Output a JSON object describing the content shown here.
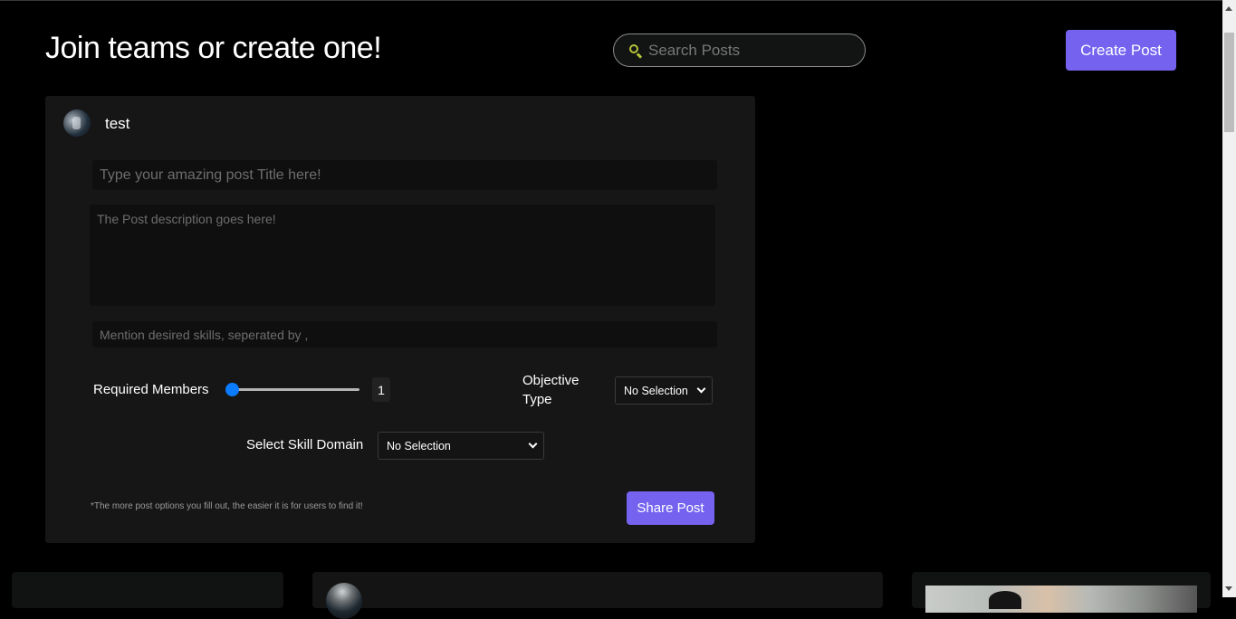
{
  "header": {
    "title": "Join teams or create one!",
    "search": {
      "placeholder": "Search Posts",
      "value": "",
      "icon": "search-icon"
    },
    "create_post_label": "Create Post"
  },
  "composer": {
    "user": {
      "name": "test",
      "avatar": "avatar"
    },
    "title_field": {
      "placeholder": "Type your amazing post Title here!",
      "value": ""
    },
    "description_field": {
      "placeholder": "The Post description goes here!",
      "value": ""
    },
    "skills_field": {
      "placeholder": "Mention desired skills, seperated by ,",
      "value": ""
    },
    "required_members": {
      "label": "Required Members",
      "value": "1"
    },
    "objective_type": {
      "label": "Objective Type",
      "selected": "No Selection"
    },
    "skill_domain": {
      "label": "Select Skill Domain",
      "selected": "No Selection"
    },
    "hint": "*The more post options you fill out, the easier it is for users to find it!",
    "share_label": "Share Post"
  },
  "colors": {
    "accent": "#7563f0",
    "search_icon": "#b5c33a",
    "slider_thumb": "#0b7cff",
    "card_bg": "#161616",
    "page_bg": "#000000"
  }
}
